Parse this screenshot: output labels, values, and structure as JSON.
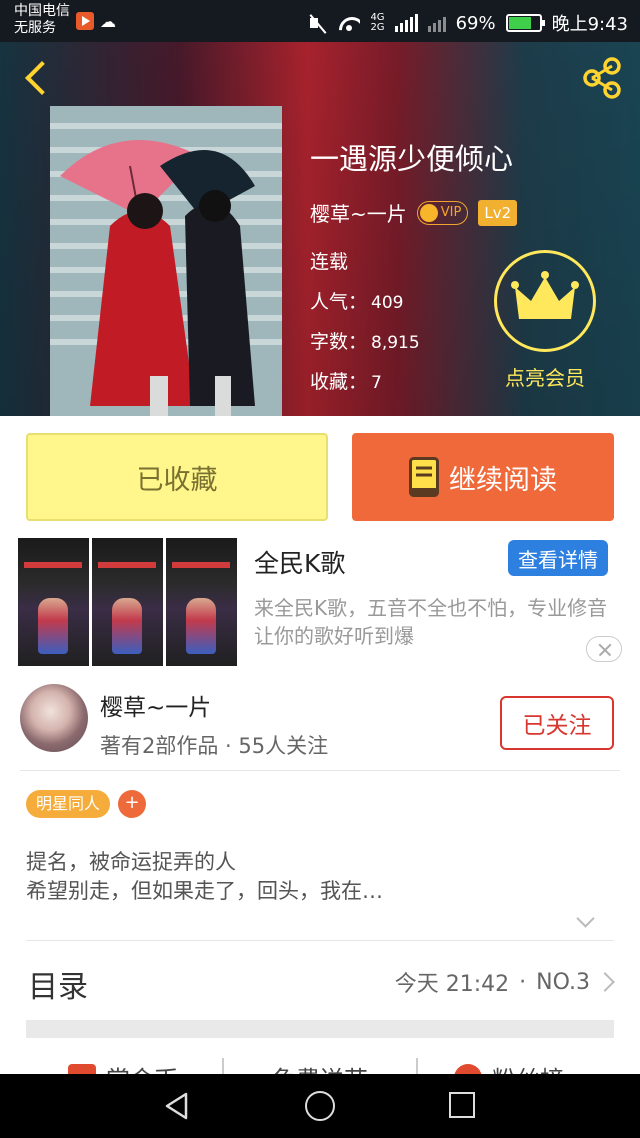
{
  "status_bar": {
    "carrier": "中国电信",
    "service": "无服务",
    "network_top": "4G",
    "network_bottom": "2G",
    "battery": "69%",
    "time": "晚上9:43"
  },
  "book": {
    "title": "一遇源少便倾心",
    "author": "樱草~一片",
    "vip_badge": "VIP",
    "level_badge": "Lv2",
    "status": "连载",
    "popularity_label": "人气：",
    "popularity": "409",
    "words_label": "字数：",
    "words": "8,915",
    "favorites_label": "收藏：",
    "favorites": "7"
  },
  "vip_cta": {
    "label": "点亮会员"
  },
  "actions": {
    "collected_label": "已收藏",
    "read_label": "继续阅读"
  },
  "ad": {
    "title": "全民K歌",
    "button": "查看详情",
    "desc": "来全民K歌，五音不全也不怕，专业修音让你的歌好听到爆"
  },
  "author": {
    "name": "樱草~一片",
    "works": "著有2部作品 · 55人关注",
    "follow_label": "已关注"
  },
  "tags": [
    {
      "label": "明星同人"
    }
  ],
  "tag_add": "+",
  "intro": {
    "line1": "提名，被命运捉弄的人",
    "line2": "希望别走，但如果走了，回头，我在…"
  },
  "toc": {
    "label": "目录",
    "updated": "今天 21:42",
    "separator": "·",
    "chapter": "NO.3"
  },
  "bottom_tabs": [
    {
      "label": "赏金币"
    },
    {
      "label": "免费送花"
    },
    {
      "label": "粉丝榜"
    }
  ],
  "colors": {
    "accent_orange": "#f0693b",
    "collected_yellow": "#fff68c",
    "follow_red": "#d8362f",
    "ad_button_blue": "#2d7fe0",
    "vip_gold": "#ffe85b"
  }
}
